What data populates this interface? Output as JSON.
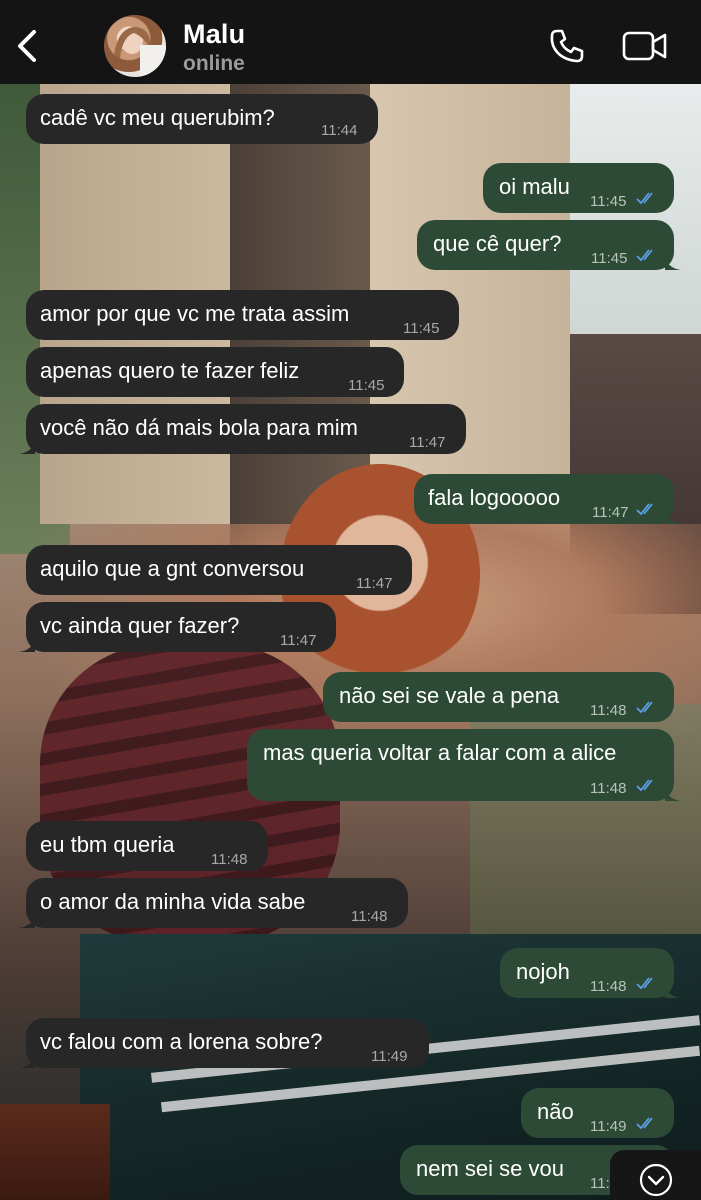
{
  "header": {
    "contact_name": "Malu",
    "status": "online",
    "back_icon": "chevron-left-icon",
    "call_icon": "phone-icon",
    "video_icon": "video-camera-icon"
  },
  "colors": {
    "header_bg": "#141414",
    "incoming_bubble": "#272727",
    "outgoing_bubble": "#2d4a36",
    "read_tick": "#5aa0e6"
  },
  "messages": [
    {
      "dir": "in",
      "text": "cadê vc meu querubim?",
      "time": "11:44"
    },
    {
      "dir": "out",
      "text": "oi malu",
      "time": "11:45",
      "read": true
    },
    {
      "dir": "out",
      "text": "que cê quer?",
      "time": "11:45",
      "read": true
    },
    {
      "dir": "in",
      "text": "amor por que vc me trata assim",
      "time": "11:45"
    },
    {
      "dir": "in",
      "text": "apenas quero te fazer feliz",
      "time": "11:45"
    },
    {
      "dir": "in",
      "text": "você não dá mais bola para mim",
      "time": "11:47"
    },
    {
      "dir": "out",
      "text": "fala logooooo",
      "time": "11:47",
      "read": true
    },
    {
      "dir": "in",
      "text": "aquilo que a gnt conversou",
      "time": "11:47"
    },
    {
      "dir": "in",
      "text": "vc ainda quer fazer?",
      "time": "11:47"
    },
    {
      "dir": "out",
      "text": "não sei se vale a pena",
      "time": "11:48",
      "read": true
    },
    {
      "dir": "out",
      "text": "mas queria voltar a falar com a alice",
      "time": "11:48",
      "read": true
    },
    {
      "dir": "in",
      "text": "eu tbm queria",
      "time": "11:48"
    },
    {
      "dir": "in",
      "text": "o amor da minha vida sabe",
      "time": "11:48"
    },
    {
      "dir": "out",
      "text": "nojoh",
      "time": "11:48",
      "read": true
    },
    {
      "dir": "in",
      "text": "vc falou com a lorena sobre?",
      "time": "11:49"
    },
    {
      "dir": "out",
      "text": "não",
      "time": "11:49",
      "read": true
    },
    {
      "dir": "out",
      "text": "nem sei se vou",
      "time": "11:",
      "read": false
    }
  ],
  "scroll_button": {
    "icon": "chevron-down-icon"
  }
}
